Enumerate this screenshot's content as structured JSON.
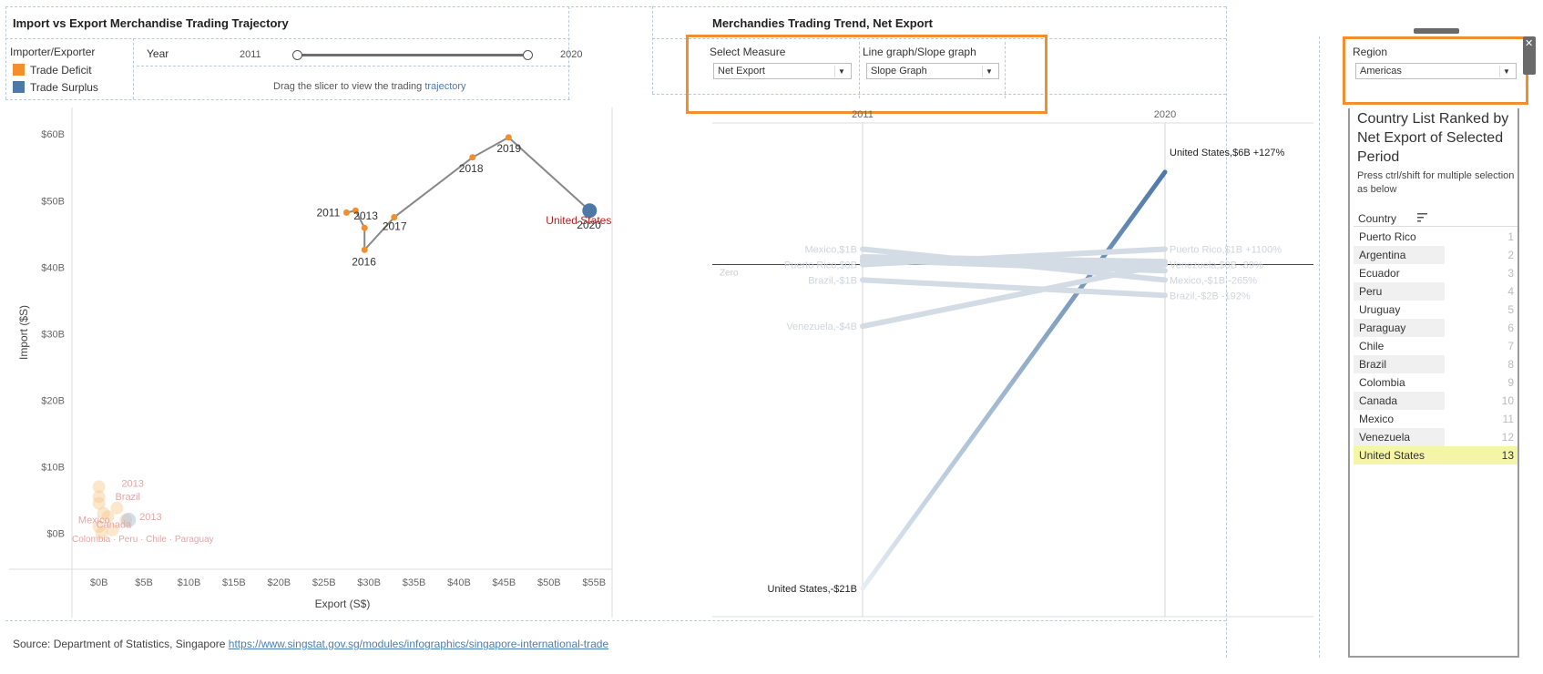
{
  "left_panel": {
    "title": "Import vs Export Merchandise Trading Trajectory",
    "legend_title": "Importer/Exporter",
    "legend": [
      {
        "label": "Trade Deficit",
        "color": "#f28e2b"
      },
      {
        "label": "Trade Surplus",
        "color": "#4e79a7"
      }
    ],
    "year_label": "Year",
    "year_start": "2011",
    "year_end": "2020",
    "slider_hint": "Drag the slicer to view the trading ",
    "slider_hint_link": "trajectory"
  },
  "right_panel": {
    "title": "Merchandies Trading Trend, Net Export",
    "measure_label": "Select Measure",
    "measure_value": "Net Export",
    "graph_label": "Line graph/Slope graph",
    "graph_value": "Slope Graph",
    "region_label": "Region",
    "region_value": "Americas"
  },
  "ranking": {
    "title": "Country List Ranked by Net Export of Selected Period",
    "hint": "Press ctrl/shift for multiple selection as below",
    "column_header": "Country",
    "sort_icon": "sort-icon",
    "rows": [
      {
        "name": "Puerto Rico",
        "rank": "1"
      },
      {
        "name": "Argentina",
        "rank": "2"
      },
      {
        "name": "Ecuador",
        "rank": "3"
      },
      {
        "name": "Peru",
        "rank": "4"
      },
      {
        "name": "Uruguay",
        "rank": "5"
      },
      {
        "name": "Paraguay",
        "rank": "6"
      },
      {
        "name": "Chile",
        "rank": "7"
      },
      {
        "name": "Brazil",
        "rank": "8"
      },
      {
        "name": "Colombia",
        "rank": "9"
      },
      {
        "name": "Canada",
        "rank": "10"
      },
      {
        "name": "Mexico",
        "rank": "11"
      },
      {
        "name": "Venezuela",
        "rank": "12"
      },
      {
        "name": "United States",
        "rank": "13"
      }
    ],
    "highlight_color": "#f5f5a8"
  },
  "footer": {
    "source": "Source: Department of Statistics, Singapore ",
    "url": "https://www.singstat.gov.sg/modules/infographics/singapore-international-trade"
  },
  "chart_data": [
    {
      "type": "scatter",
      "title": "",
      "xlabel": "Export (S$)",
      "ylabel": "Import ($S)",
      "xlim": [
        -3,
        57
      ],
      "ylim": [
        -5,
        64
      ],
      "x_ticks": [
        "$0B",
        "$5B",
        "$10B",
        "$15B",
        "$20B",
        "$25B",
        "$30B",
        "$35B",
        "$40B",
        "$45B",
        "$50B",
        "$55B"
      ],
      "x_tick_values": [
        0,
        5,
        10,
        15,
        20,
        25,
        30,
        35,
        40,
        45,
        50,
        55
      ],
      "y_ticks": [
        "$0B",
        "$10B",
        "$20B",
        "$30B",
        "$40B",
        "$50B",
        "$60B"
      ],
      "y_tick_values": [
        0,
        10,
        20,
        30,
        40,
        50,
        60
      ],
      "trajectory": {
        "name": "United States",
        "points": [
          {
            "year": "2011",
            "x": 27.5,
            "y": 48.2,
            "label": "2011"
          },
          {
            "year": "2012",
            "x": 28.5,
            "y": 48.5,
            "label": ""
          },
          {
            "year": "2013",
            "x": 29.5,
            "y": 45.9,
            "label": "2013"
          },
          {
            "year": "2016",
            "x": 29.5,
            "y": 42.6,
            "label": "2016"
          },
          {
            "year": "2017",
            "x": 32.8,
            "y": 47.5,
            "label": "2017"
          },
          {
            "year": "2018",
            "x": 41.5,
            "y": 56.5,
            "label": "2018"
          },
          {
            "year": "2019",
            "x": 45.5,
            "y": 59.5,
            "label": "2019"
          },
          {
            "year": "2020",
            "x": 54.5,
            "y": 48.5,
            "label": "2020"
          }
        ],
        "end_label": "United States"
      },
      "faded_labels": [
        {
          "text": "2013",
          "x": 2.5,
          "y": 7
        },
        {
          "text": "Brazil",
          "x": 1.8,
          "y": 5
        },
        {
          "text": "2013",
          "x": 4.5,
          "y": 2
        },
        {
          "text": "Mexico",
          "x": -2.3,
          "y": 1.5
        },
        {
          "text": "Canada",
          "x": -0.3,
          "y": 0.8
        }
      ],
      "faded_points": [
        {
          "x": 0,
          "y": 7
        },
        {
          "x": 0,
          "y": 5.5
        },
        {
          "x": 0,
          "y": 4.5
        },
        {
          "x": 0.5,
          "y": 3
        },
        {
          "x": 1,
          "y": 2.5
        },
        {
          "x": 2,
          "y": 3.8
        },
        {
          "x": 3,
          "y": 2
        },
        {
          "x": 1.5,
          "y": 0.5
        },
        {
          "x": 0,
          "y": 1
        },
        {
          "x": 0.3,
          "y": 0
        }
      ]
    },
    {
      "type": "line",
      "title": "",
      "x": [
        "2011",
        "2020"
      ],
      "zero_label": "Zero",
      "ylim": [
        -22,
        8
      ],
      "series": [
        {
          "name": "United States",
          "values": [
            -21,
            6
          ],
          "start_label": "United States,-$21B",
          "end_label": "United States,$6B +127%"
        },
        {
          "name": "Mexico",
          "values": [
            1,
            -1
          ],
          "start_label": "Mexico,$1B",
          "end_label": "Mexico,-$1B -265%"
        },
        {
          "name": "Puerto Rico",
          "values": [
            0,
            1
          ],
          "start_label": "Puerto Rico,$0B",
          "end_label": "Puerto Rico,$1B +1100%"
        },
        {
          "name": "Brazil",
          "values": [
            -1,
            -2
          ],
          "start_label": "Brazil,-$1B",
          "end_label": "Brazil,-$2B -192%"
        },
        {
          "name": "Venezuela",
          "values": [
            -4,
            0
          ],
          "start_label": "Venezuela,-$4B",
          "end_label": "Venezuela,$0B -89%"
        },
        {
          "name": "Argentina",
          "values": [
            0.5,
            0.2
          ]
        },
        {
          "name": "Chile",
          "values": [
            0.2,
            0.0
          ]
        },
        {
          "name": "Canada",
          "values": [
            0.3,
            -0.4
          ]
        }
      ]
    }
  ]
}
